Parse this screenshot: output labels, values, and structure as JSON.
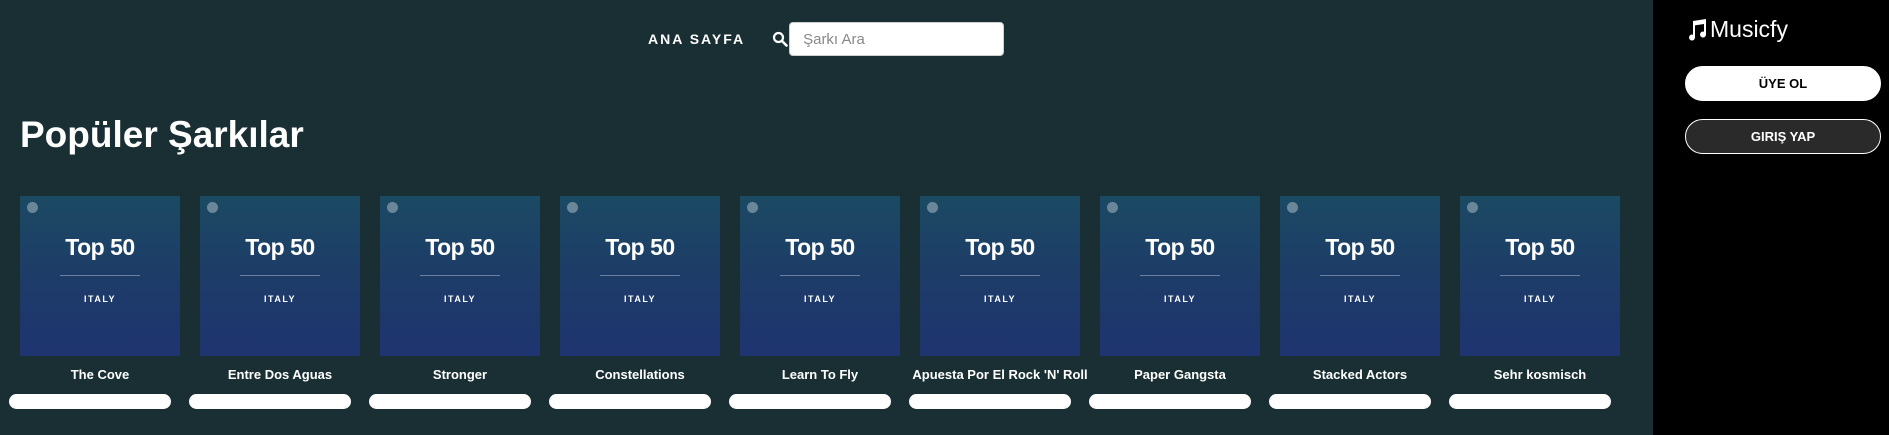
{
  "nav": {
    "home_label": "ANA SAYFA",
    "search_placeholder": "Şarkı Ara",
    "search_value": ""
  },
  "main": {
    "title": "Popüler Şarkılar",
    "cards": [
      {
        "cover_title": "Top 50",
        "cover_subtitle": "ITALY",
        "song": "The Cove"
      },
      {
        "cover_title": "Top 50",
        "cover_subtitle": "ITALY",
        "song": "Entre Dos Aguas"
      },
      {
        "cover_title": "Top 50",
        "cover_subtitle": "ITALY",
        "song": "Stronger"
      },
      {
        "cover_title": "Top 50",
        "cover_subtitle": "ITALY",
        "song": "Constellations"
      },
      {
        "cover_title": "Top 50",
        "cover_subtitle": "ITALY",
        "song": "Learn To Fly"
      },
      {
        "cover_title": "Top 50",
        "cover_subtitle": "ITALY",
        "song": "Apuesta Por El Rock 'N' Roll"
      },
      {
        "cover_title": "Top 50",
        "cover_subtitle": "ITALY",
        "song": "Paper Gangsta"
      },
      {
        "cover_title": "Top 50",
        "cover_subtitle": "ITALY",
        "song": "Stacked Actors"
      },
      {
        "cover_title": "Top 50",
        "cover_subtitle": "ITALY",
        "song": "Sehr kosmisch"
      }
    ]
  },
  "sidebar": {
    "brand": "Musicfy",
    "brand_icon": "music-note-icon",
    "signup_label": "ÜYE OL",
    "login_label": "GIRIŞ YAP"
  },
  "colors": {
    "background": "#1a2f33",
    "sidebar": "#000000",
    "cover_top": "#1b4a63",
    "cover_bottom": "#1f3470"
  }
}
